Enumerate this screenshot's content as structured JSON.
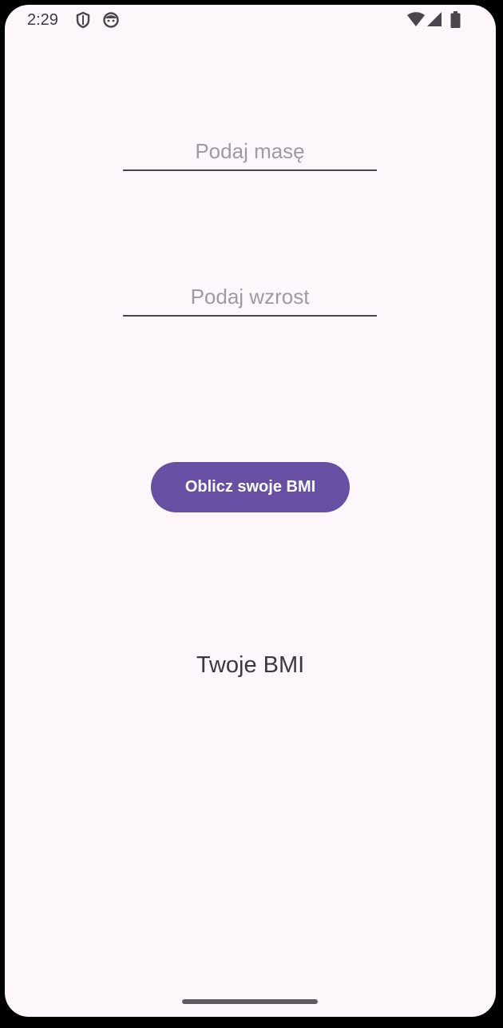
{
  "status_bar": {
    "time": "2:29",
    "icons": [
      "shield-icon",
      "face-icon",
      "wifi-icon",
      "cellular-icon",
      "battery-icon"
    ]
  },
  "form": {
    "mass_placeholder": "Podaj masę",
    "mass_value": "",
    "height_placeholder": "Podaj wzrost",
    "height_value": ""
  },
  "actions": {
    "calculate_label": "Oblicz swoje BMI"
  },
  "result": {
    "label": "Twoje BMI"
  },
  "colors": {
    "background": "#FDF7FC",
    "primary": "#6750A4",
    "on_primary": "#FFFFFF",
    "placeholder": "#9E99A2",
    "text": "#3C3840"
  }
}
